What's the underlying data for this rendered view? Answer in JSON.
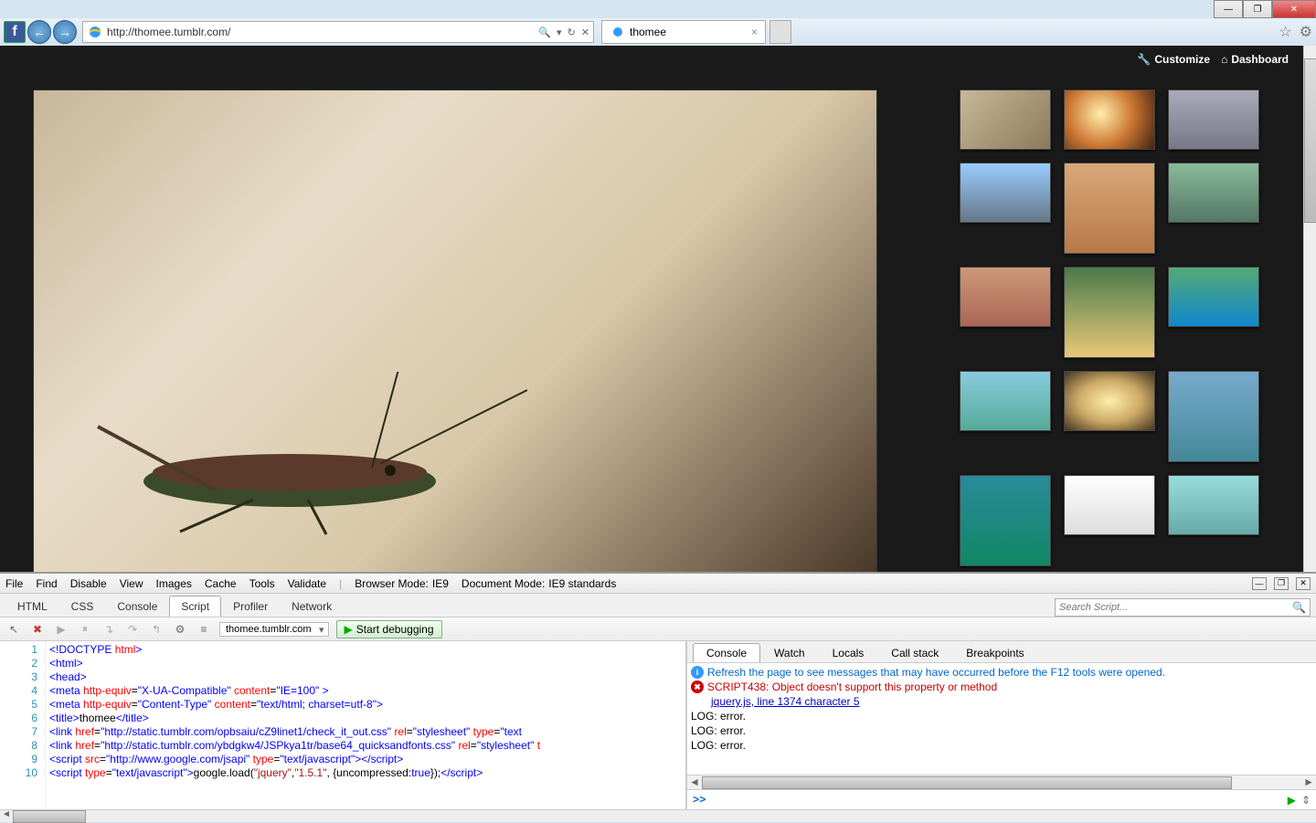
{
  "window": {
    "min": "—",
    "max": "❐",
    "close": "✕"
  },
  "browser": {
    "url": "http://thomee.tumblr.com/",
    "search_icon": "🔍",
    "refresh_icon": "↻",
    "stop_icon": "✕",
    "tab_title": "thomee",
    "fav_icon": "☆",
    "gear_icon": "⚙"
  },
  "page": {
    "customize": "Customize",
    "dashboard": "Dashboard"
  },
  "devtools": {
    "menu": [
      "File",
      "Find",
      "Disable",
      "View",
      "Images",
      "Cache",
      "Tools",
      "Validate"
    ],
    "browser_mode_label": "Browser Mode:",
    "browser_mode_value": "IE9",
    "doc_mode_label": "Document Mode:",
    "doc_mode_value": "IE9 standards",
    "tabs": [
      "HTML",
      "CSS",
      "Console",
      "Script",
      "Profiler",
      "Network"
    ],
    "active_tab": "Script",
    "search_placeholder": "Search Script...",
    "file_dropdown": "thomee.tumblr.com",
    "start_debugging": "Start debugging",
    "right_tabs": [
      "Console",
      "Watch",
      "Locals",
      "Call stack",
      "Breakpoints"
    ],
    "active_right_tab": "Console",
    "code_lines": [
      {
        "n": 1,
        "html": "<span class='tag-blue'>&lt;!DOCTYPE</span> <span class='attr-red'>html</span><span class='tag-blue'>&gt;</span>"
      },
      {
        "n": 2,
        "html": "<span class='tag-blue'>&lt;html&gt;</span>"
      },
      {
        "n": 3,
        "html": "<span class='tag-blue'>&lt;head&gt;</span>"
      },
      {
        "n": 4,
        "html": "<span class='tag-blue'>&lt;meta</span> <span class='attr-red'>http-equiv</span>=<span class='tag-blue'>\"X-UA-Compatible\"</span> <span class='attr-red'>content</span>=<span class='tag-blue'>\"IE=100\"</span> <span class='tag-blue'>&gt;</span>"
      },
      {
        "n": 5,
        "html": "<span class='tag-blue'>&lt;meta</span> <span class='attr-red'>http-equiv</span>=<span class='tag-blue'>\"Content-Type\"</span> <span class='attr-red'>content</span>=<span class='tag-blue'>\"text/html; charset=utf-8\"</span><span class='tag-blue'>&gt;</span>"
      },
      {
        "n": 6,
        "html": "<span class='tag-blue'>&lt;title&gt;</span>thomee<span class='tag-blue'>&lt;/title&gt;</span>"
      },
      {
        "n": 7,
        "html": "<span class='tag-blue'>&lt;link</span> <span class='attr-red'>href</span>=<span class='tag-blue'>\"http://static.tumblr.com/opbsaiu/cZ9linet1/check_it_out.css\"</span> <span class='attr-red'>rel</span>=<span class='tag-blue'>\"stylesheet\"</span> <span class='attr-red'>type</span>=<span class='tag-blue'>\"text</span>"
      },
      {
        "n": 8,
        "html": "<span class='tag-blue'>&lt;link</span> <span class='attr-red'>href</span>=<span class='tag-blue'>\"http://static.tumblr.com/ybdgkw4/JSPkya1tr/base64_quicksandfonts.css\"</span> <span class='attr-red'>rel</span>=<span class='tag-blue'>\"stylesheet\"</span> <span class='attr-red'>t</span>"
      },
      {
        "n": 9,
        "html": "<span class='tag-blue'>&lt;script</span> <span class='attr-red'>src</span>=<span class='tag-blue'>\"http://www.google.com/jsapi\"</span> <span class='attr-red'>type</span>=<span class='tag-blue'>\"text/javascript\"</span><span class='tag-blue'>&gt;&lt;/script&gt;</span>"
      },
      {
        "n": 10,
        "html": "<span class='tag-blue'>&lt;script</span> <span class='attr-red'>type</span>=<span class='tag-blue'>\"text/javascript\"</span><span class='tag-blue'>&gt;</span>google.load(<span class='tag-brown'>\"jquery\"</span>,<span class='tag-brown'>\"1.5.1\"</span>, {uncompressed:<span class='tag-blue'>true</span>});<span class='tag-blue'>&lt;/script&gt;</span>"
      }
    ],
    "console": {
      "info_msg": "Refresh the page to see messages that may have occurred before the F12 tools were opened.",
      "error_msg": "SCRIPT438: Object doesn't support this property or method",
      "error_link": "jquery.js, line 1374 character 5",
      "log1": "LOG: error.",
      "log2": "LOG: error.",
      "log3": "LOG: error.",
      "prompt": ">>"
    }
  }
}
